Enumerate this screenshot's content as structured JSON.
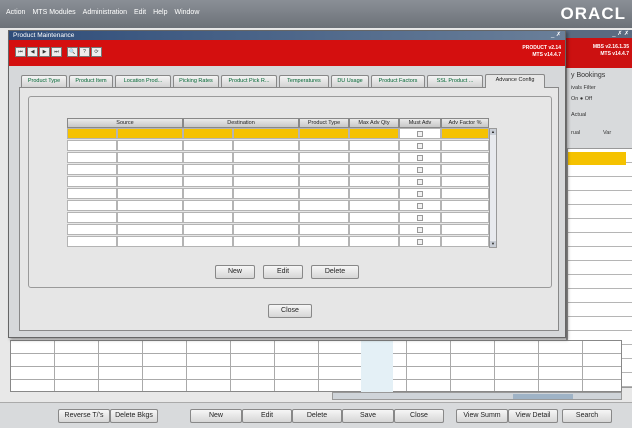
{
  "app": {
    "menu": [
      "Action",
      "MTS Modules",
      "Administration",
      "Edit",
      "Help",
      "Window"
    ],
    "brand": "ORACL"
  },
  "background": {
    "title_ctl": "_ ✗ ✗",
    "version_line1": "MBS v2.16.1.35",
    "version_line2": "MTS v14.4.7",
    "panel_title": "y Bookings",
    "filter_label": "ivals Filter",
    "on_label": "On",
    "off_label": "Off",
    "actual_label": "Actual",
    "col1": "rual",
    "col2": "Var",
    "buttons": [
      "Reverse T/'s",
      "Delete Bkgs",
      "New",
      "Edit",
      "Delete",
      "Save",
      "Close",
      "View Summ",
      "View Detail",
      "Search"
    ]
  },
  "dialog": {
    "title": "Product Maintenance",
    "title_ctl": "_ ✗",
    "toolbar": [
      "⏮",
      "◀",
      "▶",
      "⏭",
      "🔍",
      "?",
      "⟳"
    ],
    "version_line1": "PRODUCT v2.14",
    "version_line2": "MTS v14.4.7",
    "tabs": [
      "Product Type",
      "Product Item",
      "Location Prod...",
      "Picking Rates",
      "Product Pick R...",
      "Temperatures",
      "DU Usage",
      "Product Factors",
      "SSL Product ...",
      "Advance Config"
    ],
    "active_tab": "Advance Config",
    "grid": {
      "columns": [
        "Source",
        "",
        "Destination",
        "",
        "Product Type",
        "Max Adv Qty",
        "Must Adv",
        "Adv Factor %"
      ],
      "row_count": 10,
      "selected_row": 0
    },
    "buttons": {
      "new": "New",
      "edit": "Edit",
      "delete": "Delete",
      "close": "Close"
    }
  }
}
